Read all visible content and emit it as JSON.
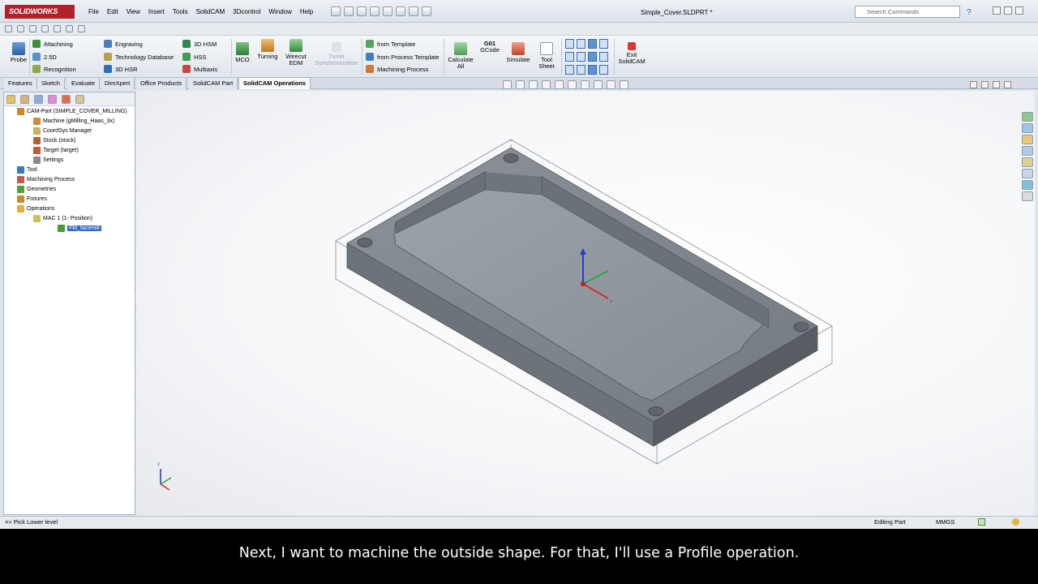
{
  "app": {
    "logo": "SOLIDWORKS",
    "document_title": "Simple_Cover.SLDPRT *"
  },
  "menu": [
    "File",
    "Edit",
    "View",
    "Insert",
    "Tools",
    "SolidCAM",
    "3Dcontrol",
    "Window",
    "Help"
  ],
  "search": {
    "placeholder": "Search Commands"
  },
  "ribbon": {
    "probe": "Probe",
    "col1": [
      "iMachining",
      "2.5D",
      "Recognition"
    ],
    "col2": [
      "Engraving",
      "Technology Database",
      "3D HSR"
    ],
    "col3": [
      "3D HSM",
      "HSS",
      "Multiaxis"
    ],
    "mco": "MCO",
    "turning": "Turning",
    "wirecut": [
      "Wirecut",
      "EDM"
    ],
    "turret": [
      "Turret",
      "Synchronization"
    ],
    "templates": [
      "from Template",
      "from Process Template",
      "Machining Process"
    ],
    "calculate": [
      "Calculate",
      "All"
    ],
    "gcode": [
      "G01",
      "GCode"
    ],
    "simulate": "Simulate",
    "toolsheet": [
      "Tool",
      "Sheet"
    ],
    "exit": [
      "Exit",
      "SolidCAM"
    ]
  },
  "tabs": [
    "Features",
    "Sketch",
    "Evaluate",
    "DimXpert",
    "Office Products",
    "SolidCAM Part",
    "SolidCAM Operations"
  ],
  "active_tab": "SolidCAM Operations",
  "tree": {
    "items": [
      {
        "label": "CAM-Part (SIMPLE_COVER_MILLING)",
        "icon": "cam-part-icon",
        "level": 0
      },
      {
        "label": "Machine (gMilling_Haas_3x)",
        "icon": "machine-icon",
        "level": 1
      },
      {
        "label": "CoordSys Manager",
        "icon": "coordsys-icon",
        "level": 1
      },
      {
        "label": "Stock (stock)",
        "icon": "stock-icon",
        "level": 1
      },
      {
        "label": "Target (target)",
        "icon": "target-icon",
        "level": 1
      },
      {
        "label": "Settings",
        "icon": "settings-icon",
        "level": 1
      },
      {
        "label": "Tool",
        "icon": "tool-icon",
        "level": 0
      },
      {
        "label": "Machining Process",
        "icon": "machining-process-icon",
        "level": 0
      },
      {
        "label": "Geometries",
        "icon": "geometries-icon",
        "level": 0
      },
      {
        "label": "Fixtures",
        "icon": "fixtures-icon",
        "level": 0
      },
      {
        "label": "Operations",
        "icon": "operations-folder-icon",
        "level": 0
      },
      {
        "label": "MAC 1 (1- Position)",
        "icon": "mac-icon",
        "level": 1
      },
      {
        "label": "FM_facemill",
        "icon": "facemill-operation-icon",
        "level": 2,
        "selected": true
      }
    ]
  },
  "status": {
    "message": "=> Pick Lower level",
    "mode": "Editing Part",
    "units": "MMGS"
  },
  "caption": "Next, I want to machine the outside shape. For that, I'll use a Profile operation.",
  "colors": {
    "accent": "#3068c4",
    "logo_red": "#b1222b",
    "part_gray": "#7f868e"
  }
}
